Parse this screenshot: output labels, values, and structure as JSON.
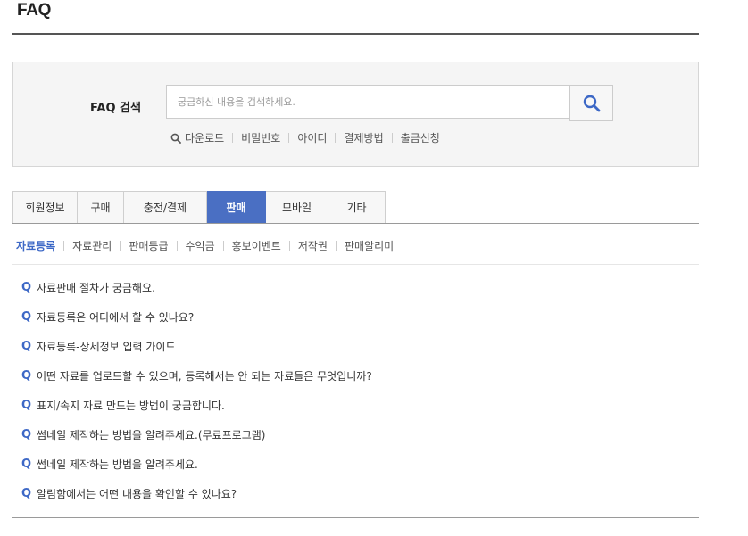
{
  "page": {
    "title": "FAQ"
  },
  "search": {
    "label": "FAQ 검색",
    "placeholder": "궁금하신 내용을 검색하세요.",
    "value": "",
    "button_icon": "search-icon",
    "quick_links": [
      "다운로드",
      "비밀번호",
      "아이디",
      "결제방법",
      "출금신청"
    ]
  },
  "tabs": [
    {
      "label": "회원정보",
      "active": false
    },
    {
      "label": "구매",
      "active": false
    },
    {
      "label": "충전/결제",
      "active": false
    },
    {
      "label": "판매",
      "active": true
    },
    {
      "label": "모바일",
      "active": false
    },
    {
      "label": "기타",
      "active": false
    }
  ],
  "subtabs": [
    {
      "label": "자료등록",
      "active": true
    },
    {
      "label": "자료관리",
      "active": false
    },
    {
      "label": "판매등급",
      "active": false
    },
    {
      "label": "수익금",
      "active": false
    },
    {
      "label": "홍보이벤트",
      "active": false
    },
    {
      "label": "저작권",
      "active": false
    },
    {
      "label": "판매알리미",
      "active": false
    }
  ],
  "faq": {
    "marker": "Q",
    "items": [
      "자료판매 절차가 궁금해요.",
      "자료등록은 어디에서 할 수 있나요?",
      "자료등록-상세정보 입력 가이드",
      "어떤 자료를 업로드할 수 있으며, 등록해서는 안 되는 자료들은 무엇입니까?",
      "표지/속지 자료 만드는 방법이 궁금합니다.",
      "썸네일 제작하는 방법을 알려주세요.(무료프로그램)",
      "썸네일 제작하는 방법을 알려주세요.",
      "알림함에서는 어떤 내용을 확인할 수 있나요?"
    ]
  },
  "colors": {
    "accent": "#4a6fc3",
    "link_active": "#3d68c6",
    "panel_bg": "#f5f5f5"
  }
}
